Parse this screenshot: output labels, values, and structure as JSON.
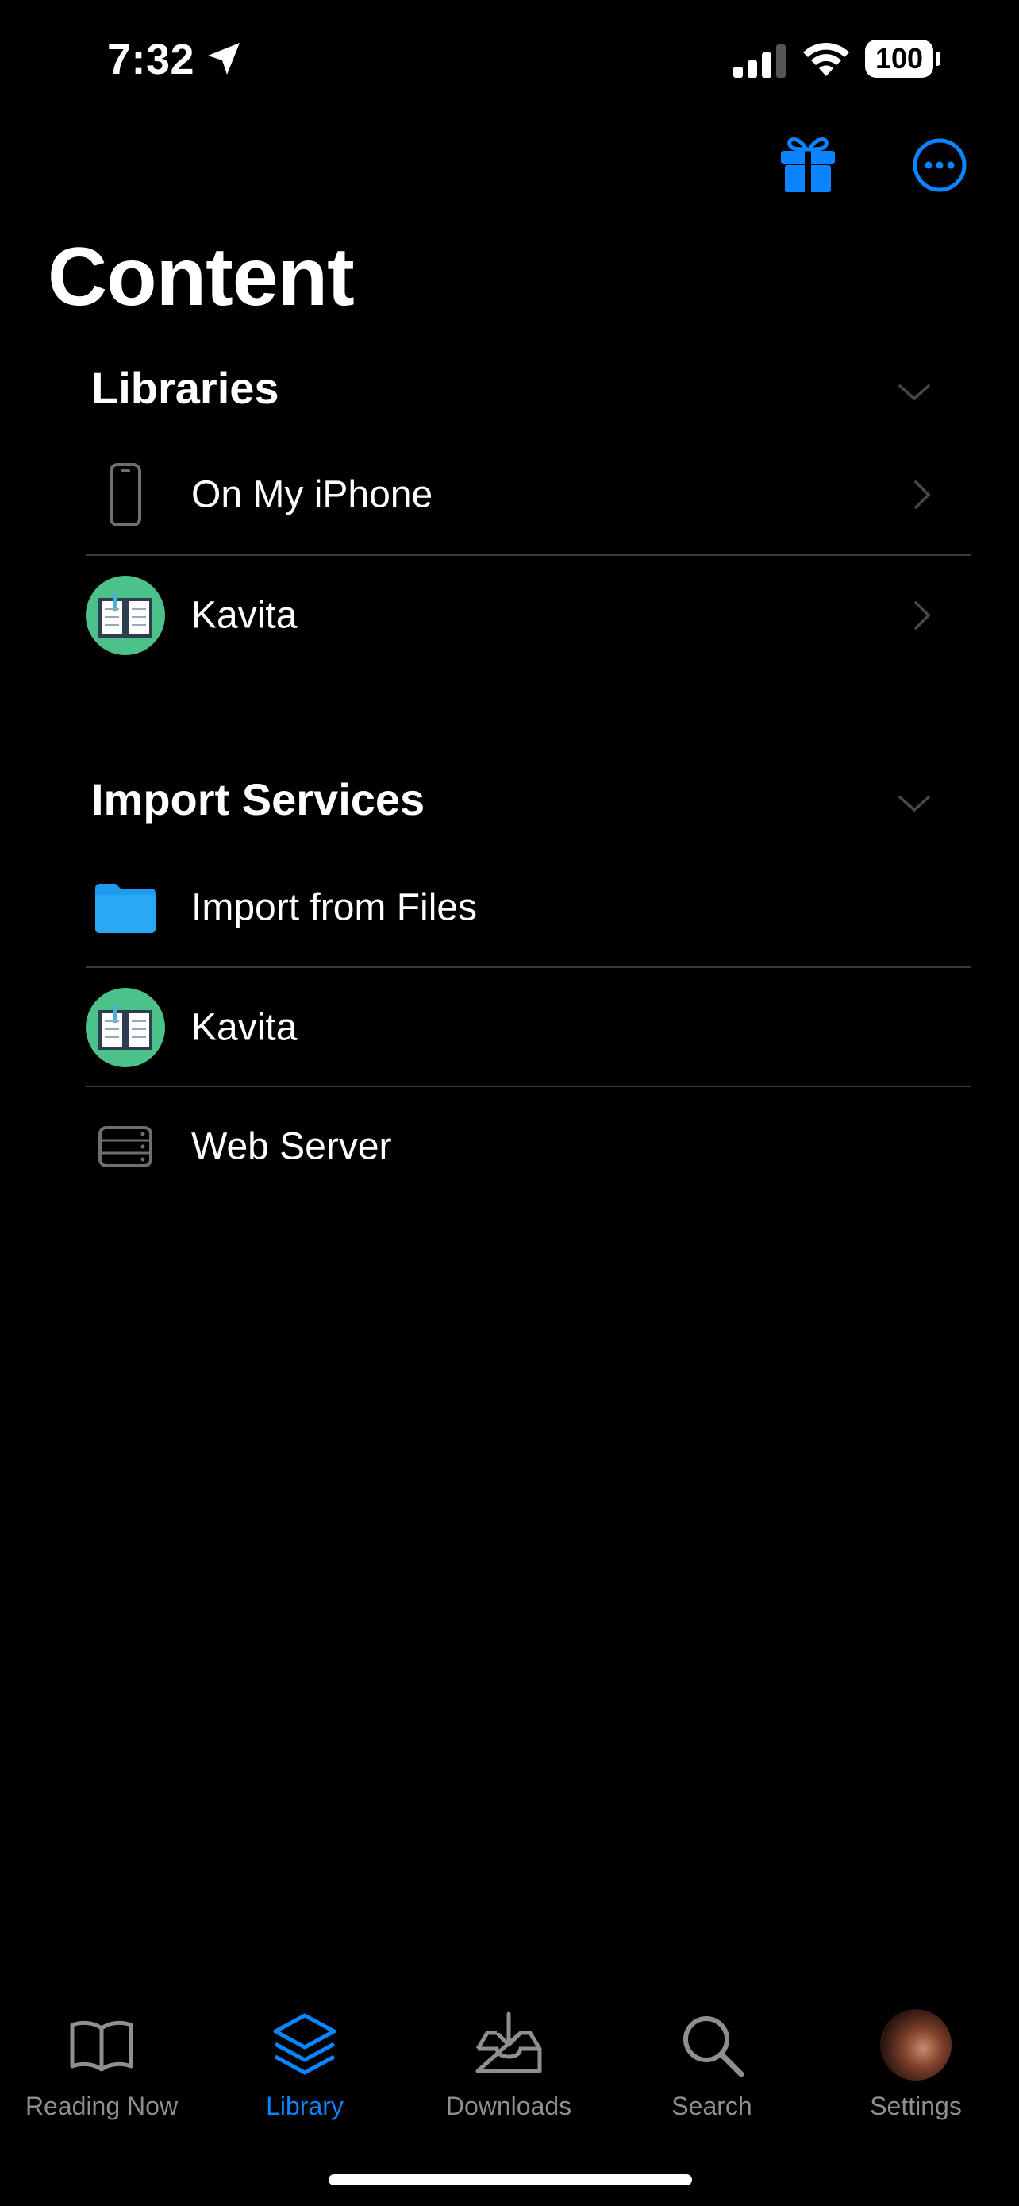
{
  "status_bar": {
    "time": "7:32",
    "battery": "100"
  },
  "header": {
    "title": "Content"
  },
  "libraries": {
    "title": "Libraries",
    "items": [
      {
        "label": "On My iPhone",
        "icon": "iphone-icon"
      },
      {
        "label": "Kavita",
        "icon": "kavita-book-icon"
      }
    ]
  },
  "import_services": {
    "title": "Import Services",
    "items": [
      {
        "label": "Import from Files",
        "icon": "folder-icon"
      },
      {
        "label": "Kavita",
        "icon": "kavita-book-icon"
      },
      {
        "label": "Web Server",
        "icon": "server-icon"
      }
    ]
  },
  "tab_bar": {
    "items": [
      {
        "label": "Reading Now",
        "icon": "book-icon",
        "active": false
      },
      {
        "label": "Library",
        "icon": "stack-icon",
        "active": true
      },
      {
        "label": "Downloads",
        "icon": "download-tray-icon",
        "active": false
      },
      {
        "label": "Search",
        "icon": "search-icon",
        "active": false
      },
      {
        "label": "Settings",
        "icon": "avatar",
        "active": false
      }
    ]
  },
  "colors": {
    "accent": "#0a84ff",
    "kavita_green": "#4cc18a",
    "folder_blue": "#1e9bf0",
    "secondary": "#8e8e93"
  }
}
